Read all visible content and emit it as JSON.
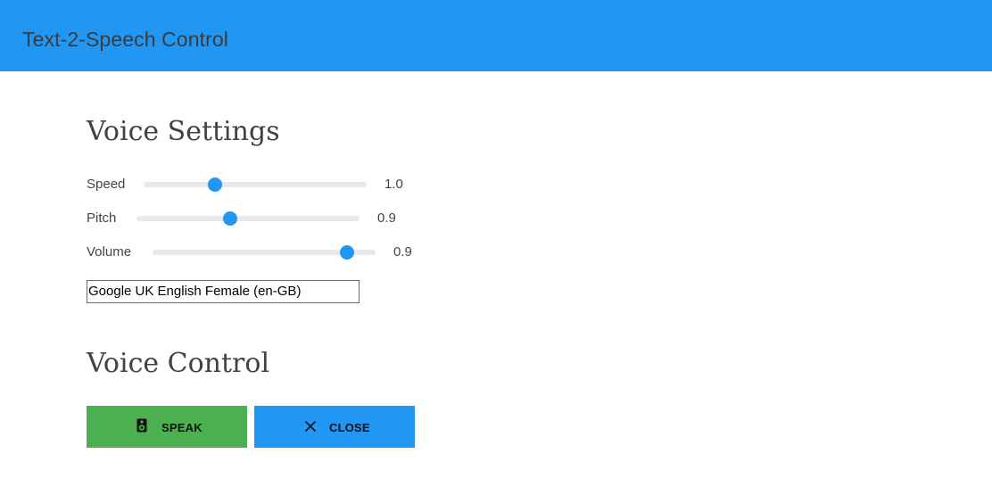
{
  "app": {
    "title": "Text-2-Speech Control"
  },
  "voice_settings": {
    "title": "Voice Settings",
    "sliders": [
      {
        "label": "Speed",
        "value": "1.0",
        "level": 0.32
      },
      {
        "label": "Pitch",
        "value": "0.9",
        "level": 0.42
      },
      {
        "label": "Volume",
        "value": "0.9",
        "level": 0.87
      }
    ],
    "voice_select": {
      "selected": "Google UK English Female (en-GB)"
    }
  },
  "voice_control": {
    "title": "Voice Control",
    "speak_button": {
      "label": "SPEAK",
      "icon": "speaker-icon"
    },
    "close_button": {
      "label": "CLOSE",
      "icon": "close-icon"
    }
  },
  "colors": {
    "primary": "#2196f3",
    "success": "#4caf50",
    "track": "#e9e9e9"
  }
}
